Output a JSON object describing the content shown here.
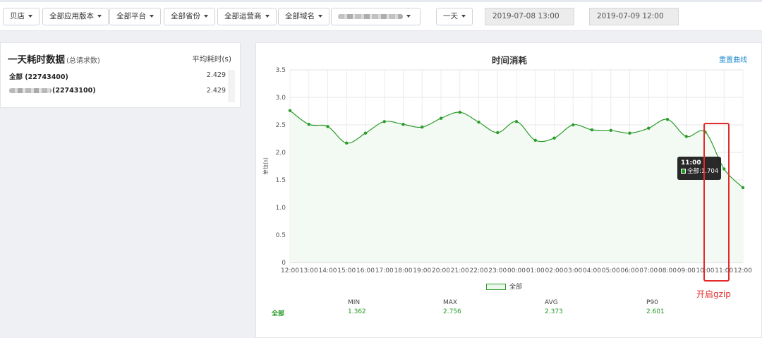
{
  "toolbar": {
    "filters": [
      {
        "name": "store-dropdown",
        "label": "贝店"
      },
      {
        "name": "app-version-dropdown",
        "label": "全部应用版本"
      },
      {
        "name": "platform-dropdown",
        "label": "全部平台"
      },
      {
        "name": "province-dropdown",
        "label": "全部省份"
      },
      {
        "name": "carrier-dropdown",
        "label": "全部运营商"
      },
      {
        "name": "domain-dropdown",
        "label": "全部域名"
      }
    ],
    "range_label": "一天",
    "start_time": "2019-07-08 13:00",
    "end_time": "2019-07-09 12:00"
  },
  "left_panel": {
    "title": "一天耗时数据",
    "subtitle": "(总请求数)",
    "column_header": "平均耗时(s)",
    "rows": [
      {
        "name": "全部 (22743400)",
        "value": "2.429"
      },
      {
        "name": "(22743100)",
        "value": "2.429"
      }
    ]
  },
  "chart_panel": {
    "title": "时间消耗",
    "reset_label": "重置曲线",
    "legend_label": "全部",
    "tooltip": {
      "time": "11:00",
      "label": "全部:",
      "value": "1.704"
    },
    "annotation": "开启gzip",
    "stats": {
      "series_name": "全部",
      "headers": [
        "MIN",
        "MAX",
        "AVG",
        "P90"
      ],
      "values": [
        "1.362",
        "2.756",
        "2.373",
        "2.601"
      ]
    }
  },
  "chart_data": {
    "type": "area",
    "title": "时间消耗",
    "ylabel": "单位(s)",
    "ylim": [
      0,
      3.5
    ],
    "yticks": [
      "0",
      "0.5",
      "1.0",
      "1.5",
      "2.0",
      "2.5",
      "3.0",
      "3.5"
    ],
    "x": [
      "12:00",
      "13:00",
      "14:00",
      "15:00",
      "16:00",
      "17:00",
      "18:00",
      "19:00",
      "20:00",
      "21:00",
      "22:00",
      "23:00",
      "00:00",
      "01:00",
      "02:00",
      "03:00",
      "04:00",
      "05:00",
      "06:00",
      "07:00",
      "08:00",
      "09:00",
      "10:00",
      "11:00",
      "12:00"
    ],
    "series": [
      {
        "name": "全部",
        "values": [
          2.76,
          2.51,
          2.47,
          2.17,
          2.35,
          2.56,
          2.51,
          2.46,
          2.62,
          2.73,
          2.55,
          2.36,
          2.56,
          2.22,
          2.26,
          2.5,
          2.41,
          2.4,
          2.35,
          2.44,
          2.6,
          2.29,
          2.37,
          1.7,
          1.36
        ]
      }
    ],
    "grid": true,
    "legend_position": "bottom",
    "colors": {
      "line": "#2b9d2b",
      "fill": "#f3f9f3",
      "annotation": "#e42a2a"
    }
  }
}
